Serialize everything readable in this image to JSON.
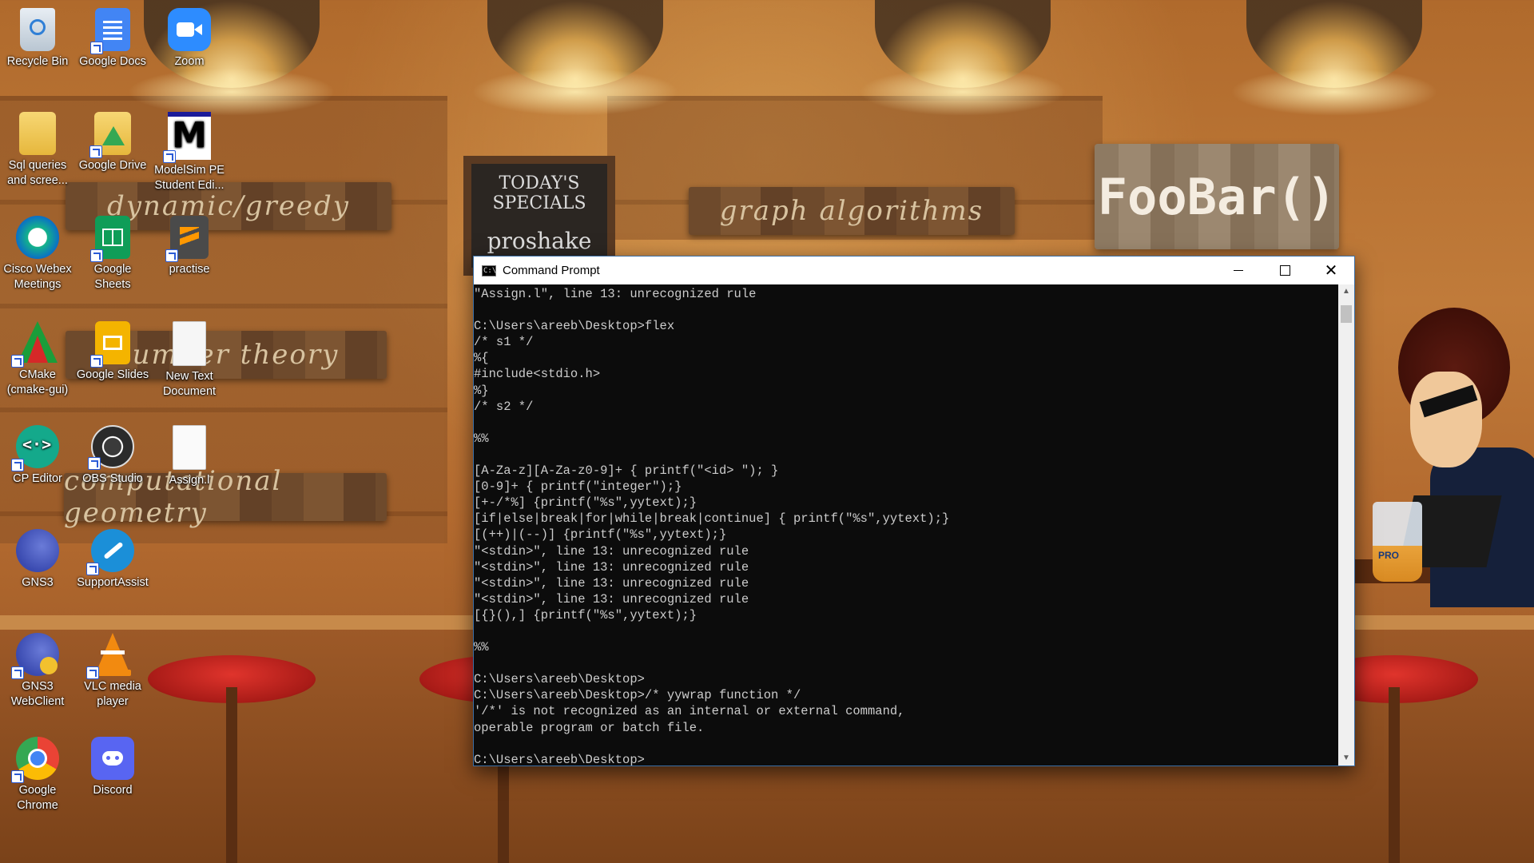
{
  "wallpaper": {
    "signs": [
      "dynamic/greedy",
      "graph algorithms",
      "number theory",
      "computational geometry"
    ],
    "board_title": "TODAY'S SPECIALS",
    "board_sub": "proshake",
    "foobar": "FooBar()",
    "cup_label": "PRO"
  },
  "desktop_icons": [
    {
      "label": "Recycle Bin",
      "icon": "recycle-bin-icon"
    },
    {
      "label": "Google Docs",
      "icon": "google-docs-icon"
    },
    {
      "label": "Zoom",
      "icon": "zoom-icon"
    },
    {
      "label": "Sql queries and scree...",
      "icon": "folder-icon"
    },
    {
      "label": "Google Drive",
      "icon": "google-drive-icon"
    },
    {
      "label": "ModelSim PE Student Edi...",
      "icon": "modelsim-icon"
    },
    {
      "label": "Cisco Webex Meetings",
      "icon": "webex-icon"
    },
    {
      "label": "Google Sheets",
      "icon": "google-sheets-icon"
    },
    {
      "label": "practise",
      "icon": "sublime-text-icon"
    },
    {
      "label": "CMake (cmake-gui)",
      "icon": "cmake-icon"
    },
    {
      "label": "Google Slides",
      "icon": "google-slides-icon"
    },
    {
      "label": "New Text Document",
      "icon": "text-document-icon"
    },
    {
      "label": "CP Editor",
      "icon": "cp-editor-icon"
    },
    {
      "label": "OBS Studio",
      "icon": "obs-studio-icon"
    },
    {
      "label": "Assign.l",
      "icon": "file-icon"
    },
    {
      "label": "GNS3",
      "icon": "gns3-icon"
    },
    {
      "label": "SupportAssist",
      "icon": "supportassist-icon"
    },
    {
      "label": "GNS3 WebClient",
      "icon": "gns3-webclient-icon"
    },
    {
      "label": "VLC media player",
      "icon": "vlc-icon"
    },
    {
      "label": "Google Chrome",
      "icon": "chrome-icon"
    },
    {
      "label": "Discord",
      "icon": "discord-icon"
    }
  ],
  "window": {
    "title": "Command Prompt",
    "app_icon_text": "C:\\",
    "minimize": "minimize",
    "maximize": "maximize",
    "close": "close",
    "output": "\"Assign.l\", line 13: unrecognized rule\n\nC:\\Users\\areeb\\Desktop>flex\n/* s1 */\n%{\n#include<stdio.h>\n%}\n/* s2 */\n\n%%\n\n[A-Za-z][A-Za-z0-9]+ { printf(\"<id> \"); }\n[0-9]+ { printf(\"integer\");}\n[+-/*%] {printf(\"%s\",yytext);}\n[if|else|break|for|while|break|continue] { printf(\"%s\",yytext);}\n[(++)|(--)] {printf(\"%s\",yytext);}\n\"<stdin>\", line 13: unrecognized rule\n\"<stdin>\", line 13: unrecognized rule\n\"<stdin>\", line 13: unrecognized rule\n\"<stdin>\", line 13: unrecognized rule\n[{}(),] {printf(\"%s\",yytext);}\n\n%%\n\nC:\\Users\\areeb\\Desktop>\nC:\\Users\\areeb\\Desktop>/* yywrap function */\n'/*' is not recognized as an internal or external command,\noperable program or batch file.\n\nC:\\Users\\areeb\\Desktop>"
  },
  "colors": {
    "console_bg": "#0c0c0c",
    "console_text": "#cccccc",
    "window_border": "#3a6ea5"
  }
}
